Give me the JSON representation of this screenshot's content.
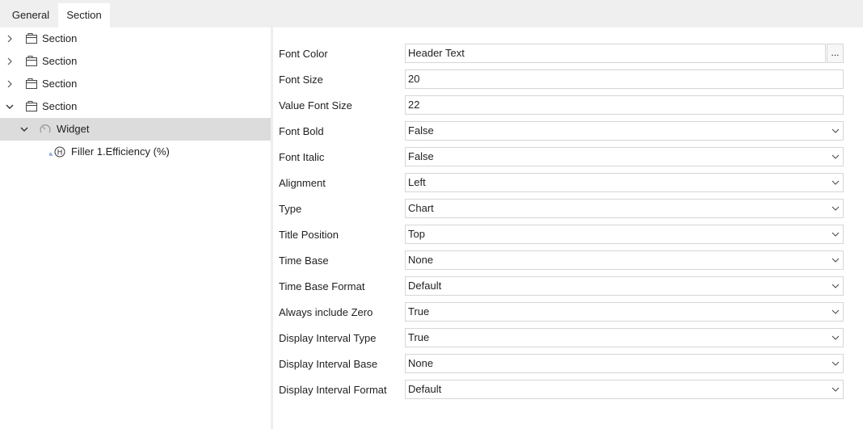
{
  "tabs": [
    {
      "label": "General"
    },
    {
      "label": "Section"
    }
  ],
  "tree": {
    "items": [
      {
        "label": "Section"
      },
      {
        "label": "Section"
      },
      {
        "label": "Section"
      },
      {
        "label": "Section"
      },
      {
        "label": "Widget"
      },
      {
        "label": "Filler 1.Efficiency (%)"
      }
    ]
  },
  "properties": [
    {
      "label": "Font Color",
      "value": "Header Text"
    },
    {
      "label": "Font Size",
      "value": "20"
    },
    {
      "label": "Value Font Size",
      "value": "22"
    },
    {
      "label": "Font Bold",
      "value": "False"
    },
    {
      "label": "Font Italic",
      "value": "False"
    },
    {
      "label": "Alignment",
      "value": "Left"
    },
    {
      "label": "Type",
      "value": "Chart"
    },
    {
      "label": "Title Position",
      "value": "Top"
    },
    {
      "label": "Time Base",
      "value": "None"
    },
    {
      "label": "Time Base Format",
      "value": "Default"
    },
    {
      "label": "Always include Zero",
      "value": "True"
    },
    {
      "label": "Display Interval Type",
      "value": "True"
    },
    {
      "label": "Display Interval Base",
      "value": "None"
    },
    {
      "label": "Display Interval Format",
      "value": "Default"
    }
  ],
  "ellipsis_label": "...",
  "icons": {
    "collapsed": "chevron-right-icon",
    "expanded": "chevron-down-icon",
    "section": "section-icon",
    "widget": "gauge-icon",
    "tag": "historian-tag-icon",
    "dropdown": "dropdown-arrow-icon"
  },
  "colors": {
    "tab_bar": "#efefef",
    "selected_row": "#dcdcdc",
    "field_border": "#d6d6d6",
    "tag_accent": "#2a6fd6"
  }
}
